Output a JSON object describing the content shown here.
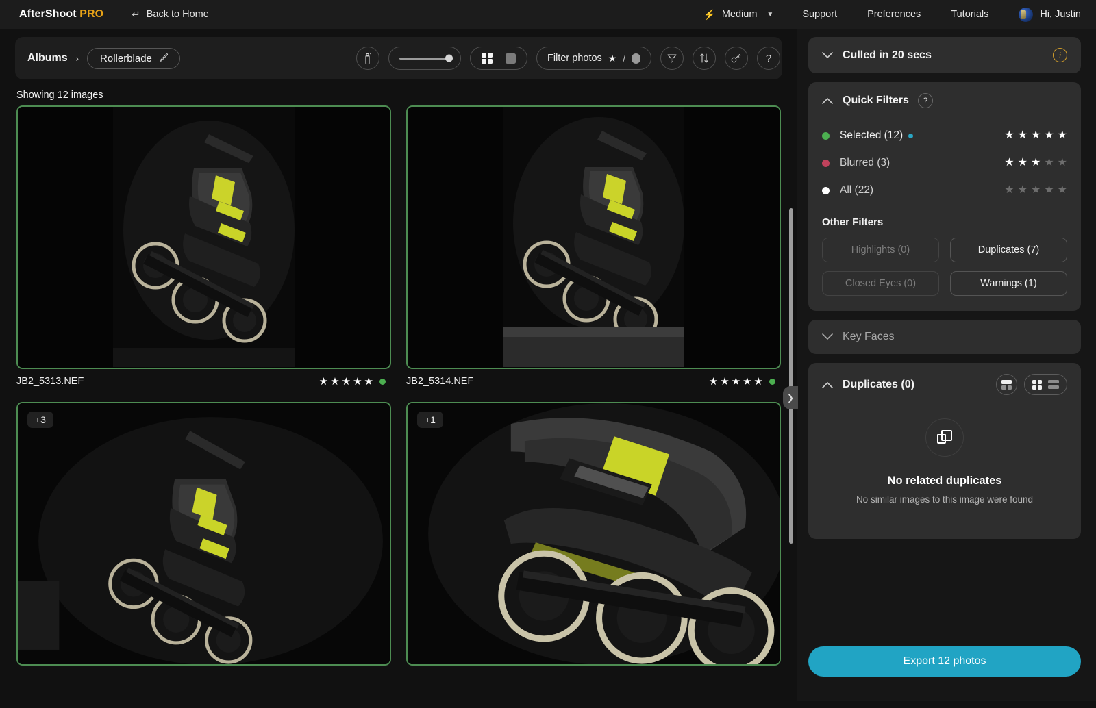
{
  "topbar": {
    "brand_main": "AfterShoot",
    "brand_pro": "PRO",
    "back_home": "Back to Home",
    "back_icon": "enter-arrow-icon",
    "performance": "Medium",
    "performance_icon": "lightning-bolt-icon",
    "links": [
      "Support",
      "Preferences",
      "Tutorials"
    ],
    "user_greeting": "Hi, Justin"
  },
  "toolbar": {
    "breadcrumb_root": "Albums",
    "breadcrumb_sep": "›",
    "album_name": "Rollerblade",
    "edit_icon": "pencil-icon",
    "culling_icon": "culling-spray-icon",
    "zoom_slider_label": "thumbnail-size-slider",
    "view_grid_icon": "grid-view-icon",
    "view_single_icon": "single-view-icon",
    "filter_label": "Filter photos",
    "filter_star_icon": "star-icon",
    "filter_sep": "/",
    "filter_circle_icon": "ellipse-icon",
    "funnel_icon": "funnel-filter-icon",
    "sort_icon": "sort-arrows-icon",
    "keyboard_icon": "shortcut-key-icon",
    "help_icon": "question-mark-icon"
  },
  "gallery": {
    "showing": "Showing 12 images",
    "photos": [
      {
        "name": "JB2_5313.NEF",
        "rating": 5,
        "selected": true,
        "badge": null,
        "orientation": "portrait"
      },
      {
        "name": "JB2_5314.NEF",
        "rating": 5,
        "selected": true,
        "badge": null,
        "orientation": "portrait"
      },
      {
        "name": "",
        "rating": 0,
        "selected": true,
        "badge": "+3",
        "orientation": "landscape"
      },
      {
        "name": "",
        "rating": 0,
        "selected": true,
        "badge": "+1",
        "orientation": "landscape"
      }
    ],
    "collapse_icon": "chevron-right-icon"
  },
  "sidebar": {
    "culled": {
      "title": "Culled in 20 secs",
      "collapse_icon": "chevron-down-icon",
      "info_icon": "info-icon"
    },
    "quick_filters": {
      "title": "Quick Filters",
      "collapse_icon": "chevron-up-icon",
      "help_icon": "question-mark-icon",
      "rows": [
        {
          "label": "Selected (12)",
          "color": "#4caf50",
          "stars_on": 5,
          "has_blue_dot": true
        },
        {
          "label": "Blurred (3)",
          "color": "#c0425c",
          "stars_on": 3,
          "has_blue_dot": false
        },
        {
          "label": "All (22)",
          "color": "#ffffff",
          "stars_on": 0,
          "has_blue_dot": false
        }
      ],
      "other_filters_title": "Other Filters",
      "chips": [
        {
          "label": "Highlights (0)",
          "disabled": true
        },
        {
          "label": "Duplicates (7)",
          "disabled": false
        },
        {
          "label": "Closed Eyes (0)",
          "disabled": true
        },
        {
          "label": "Warnings (1)",
          "disabled": false
        }
      ]
    },
    "key_faces": {
      "title": "Key Faces",
      "collapse_icon": "chevron-down-icon"
    },
    "duplicates": {
      "title": "Duplicates (0)",
      "collapse_icon": "chevron-up-icon",
      "view_split_icon": "split-view-icon",
      "view_grid_icon": "grid-view-icon",
      "view_list_icon": "list-view-icon",
      "empty_icon": "copy-duplicate-icon",
      "empty_title": "No related duplicates",
      "empty_subtitle": "No similar images to this image were found"
    },
    "export_button": "Export 12 photos"
  },
  "colors": {
    "accent_export": "#21a4c4",
    "selected_green": "#4caf50",
    "blurred_red": "#c0425c",
    "brand_orange": "#e8a317",
    "info_yellow": "#d9a32a"
  }
}
